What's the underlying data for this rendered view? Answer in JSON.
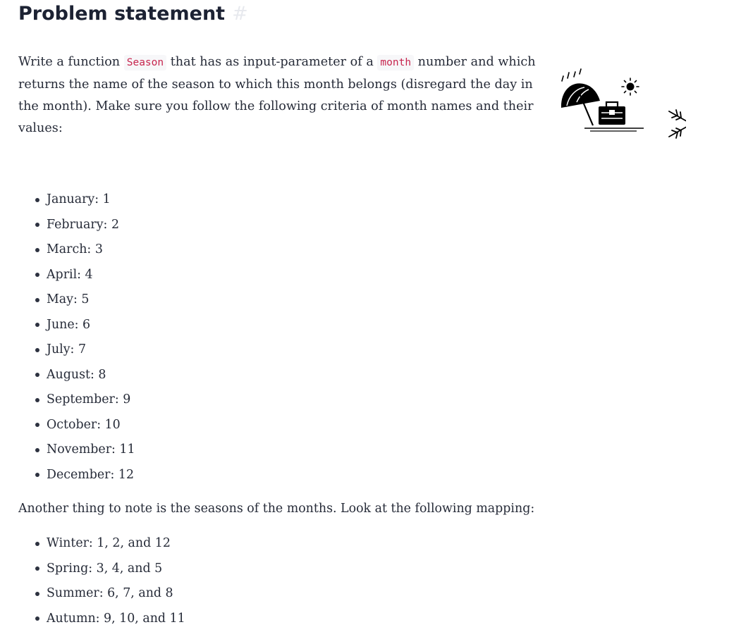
{
  "heading": {
    "title": "Problem statement",
    "anchor": "#"
  },
  "intro": {
    "part1": "Write a function ",
    "code1": "Season",
    "part2": " that has as input-parameter of a ",
    "code2": "month",
    "part3": " number and which returns the name of the season to which this month belongs (disregard the day in the month). Make sure you follow the following criteria of month names and their values:"
  },
  "illustration": {
    "summer_icon": "umbrella-beach-suitcase-sun-icon",
    "winter_icon": "snowflake-icon"
  },
  "months": [
    "January: 1",
    "February: 2",
    "March: 3",
    "April: 4",
    "May: 5",
    "June: 6",
    "July: 7",
    "August: 8",
    "September: 9",
    "October: 10",
    "November: 11",
    "December: 12"
  ],
  "note": "Another thing to note is the seasons of the months. Look at the following mapping:",
  "seasons": [
    "Winter: 1, 2, and 12",
    "Spring: 3, 4, and 5",
    "Summer: 6, 7, and 8",
    "Autumn: 9, 10, and 11"
  ]
}
